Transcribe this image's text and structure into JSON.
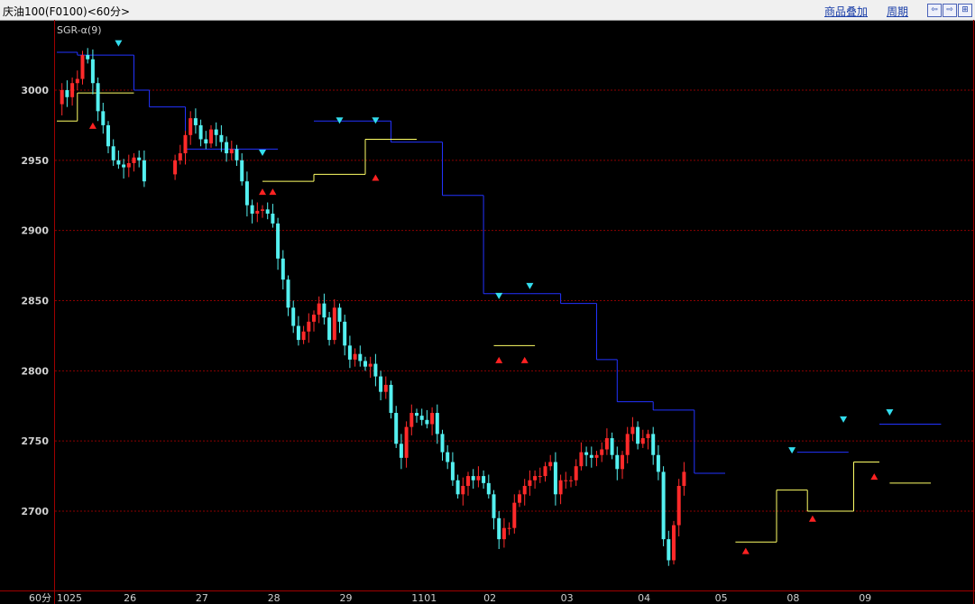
{
  "header": {
    "title": "庆油100(F0100)<60分>",
    "overlay_label": "商品叠加",
    "period_label": "周期",
    "nav_left": "⇦",
    "nav_right": "⇨",
    "nav_expand": "⊞"
  },
  "indicator_label": "SGR-α(9)",
  "period_corner": "60分",
  "colors": {
    "up": "#ff2a2a",
    "down": "#54f0f0",
    "stop_upper": "#2233ff",
    "stop_lower": "#ffff66",
    "signal_sell": "#33ddee",
    "signal_buy": "#ff2222",
    "grid": "#8b0000"
  },
  "chart_data": {
    "type": "candlestick",
    "title": "SGR-α(9)",
    "ylim": [
      2640,
      3050
    ],
    "y_ticks": [
      2700,
      2750,
      2800,
      2850,
      2900,
      2950,
      3000
    ],
    "x_labels": [
      "1025",
      "26",
      "27",
      "28",
      "29",
      "1101",
      "02",
      "03",
      "04",
      "05",
      "08",
      "09"
    ],
    "close_path": [
      2990,
      3000,
      2995,
      3005,
      3008,
      3025,
      3022,
      3005,
      2985,
      2975,
      2960,
      2950,
      2947,
      2945,
      2948,
      2952,
      2950,
      2935,
      null,
      null,
      null,
      null,
      2940,
      2950,
      2955,
      2968,
      2980,
      2975,
      2965,
      2962,
      2972,
      2968,
      2963,
      2955,
      2958,
      2950,
      2935,
      2918,
      2912,
      2914,
      2915,
      2912,
      2905,
      2880,
      2865,
      2845,
      2832,
      2822,
      2828,
      2835,
      2840,
      2848,
      2838,
      2822,
      2845,
      2835,
      2818,
      2808,
      2812,
      2807,
      2803,
      2805,
      2796,
      2785,
      2790,
      2770,
      2748,
      2738,
      2760,
      2770,
      2768,
      2765,
      2762,
      2770,
      2755,
      2742,
      2735,
      2722,
      2712,
      2718,
      2725,
      2722,
      2725,
      2720,
      2712,
      2695,
      2680,
      2688,
      2688,
      2706,
      2712,
      2718,
      2722,
      2725,
      2725,
      2732,
      2735,
      2712,
      2722,
      2722,
      2722,
      2732,
      2742,
      2740,
      2738,
      2740,
      2744,
      2752,
      2740,
      2730,
      2740,
      2755,
      2760,
      2748,
      2752,
      2755,
      2740,
      2728,
      2680,
      2665,
      2690,
      2718,
      2728
    ],
    "upper_stop": [
      {
        "from": 0,
        "to": 4,
        "value": 3027
      },
      {
        "from": 4,
        "to": 15,
        "value": 3025
      },
      {
        "from": 15,
        "to": 18,
        "value": 3000
      },
      {
        "from": 18,
        "to": 25,
        "value": 2988
      },
      {
        "from": 25,
        "to": 32,
        "value": 2958
      },
      {
        "from": 32,
        "to": 43,
        "value": 2958
      },
      {
        "from": 50,
        "to": 65,
        "value": 2978
      },
      {
        "from": 65,
        "to": 75,
        "value": 2963
      },
      {
        "from": 75,
        "to": 83,
        "value": 2925
      },
      {
        "from": 83,
        "to": 92,
        "value": 2855
      },
      {
        "from": 92,
        "to": 98,
        "value": 2855
      },
      {
        "from": 98,
        "to": 105,
        "value": 2848
      },
      {
        "from": 105,
        "to": 109,
        "value": 2808
      },
      {
        "from": 109,
        "to": 116,
        "value": 2778
      },
      {
        "from": 116,
        "to": 124,
        "value": 2772
      },
      {
        "from": 124,
        "to": 130,
        "value": 2727
      },
      {
        "from": 144,
        "to": 154,
        "value": 2742
      },
      {
        "from": 160,
        "to": 172,
        "value": 2762
      }
    ],
    "lower_stop": [
      {
        "from": 0,
        "to": 4,
        "value": 2978
      },
      {
        "from": 4,
        "to": 15,
        "value": 2998
      },
      {
        "from": 40,
        "to": 50,
        "value": 2935
      },
      {
        "from": 50,
        "to": 60,
        "value": 2940
      },
      {
        "from": 60,
        "to": 70,
        "value": 2965
      },
      {
        "from": 85,
        "to": 90,
        "value": 2818
      },
      {
        "from": 90,
        "to": 93,
        "value": 2818
      },
      {
        "from": 132,
        "to": 140,
        "value": 2678
      },
      {
        "from": 140,
        "to": 146,
        "value": 2715
      },
      {
        "from": 146,
        "to": 155,
        "value": 2700
      },
      {
        "from": 155,
        "to": 160,
        "value": 2735
      },
      {
        "from": 162,
        "to": 170,
        "value": 2720
      }
    ],
    "sell_signals": [
      {
        "x": 12,
        "value": 3033
      },
      {
        "x": 40,
        "value": 2955
      },
      {
        "x": 55,
        "value": 2978
      },
      {
        "x": 62,
        "value": 2978
      },
      {
        "x": 86,
        "value": 2853
      },
      {
        "x": 92,
        "value": 2860
      },
      {
        "x": 143,
        "value": 2743
      },
      {
        "x": 153,
        "value": 2765
      },
      {
        "x": 162,
        "value": 2770
      }
    ],
    "buy_signals": [
      {
        "x": 7,
        "value": 2975
      },
      {
        "x": 40,
        "value": 2928
      },
      {
        "x": 42,
        "value": 2928
      },
      {
        "x": 62,
        "value": 2938
      },
      {
        "x": 86,
        "value": 2808
      },
      {
        "x": 91,
        "value": 2808
      },
      {
        "x": 134,
        "value": 2672
      },
      {
        "x": 147,
        "value": 2695
      },
      {
        "x": 159,
        "value": 2725
      }
    ]
  }
}
